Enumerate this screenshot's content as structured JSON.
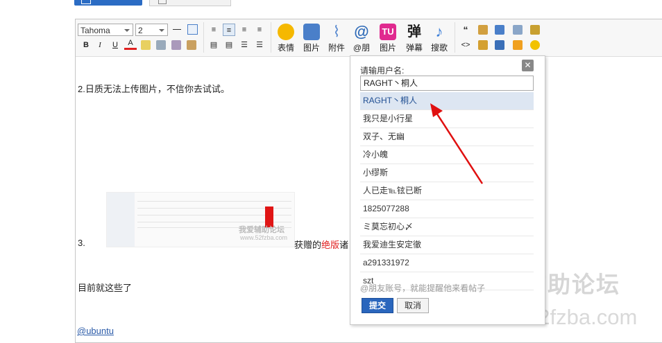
{
  "toolbar": {
    "font_family": "Tahoma",
    "font_size": "2",
    "format_buttons": [
      {
        "label": "B",
        "icon": "bold-icon"
      },
      {
        "label": "I",
        "icon": "italic-icon"
      },
      {
        "label": "U",
        "icon": "underline-icon"
      },
      {
        "label": "A",
        "icon": "font-color-icon"
      }
    ],
    "big_buttons": [
      {
        "label": "表情",
        "icon": "smiley-icon",
        "color": "#f5b800"
      },
      {
        "label": "图片",
        "icon": "image-icon",
        "color": "#4a7fc9"
      },
      {
        "label": "附件",
        "icon": "paperclip-icon",
        "color": "#5b8bd0"
      },
      {
        "label": "@朋",
        "icon": "at-icon",
        "color": "#2f6bb8"
      },
      {
        "label": "图片",
        "icon": "tu-icon",
        "color": "#e02a8f",
        "glyph": "TU"
      },
      {
        "label": "弹幕",
        "icon": "danmu-icon",
        "color": "#222222",
        "glyph": "弹"
      },
      {
        "label": "搜歌",
        "icon": "music-note-icon",
        "color": "#3c7fd8",
        "glyph": "♪"
      }
    ]
  },
  "content": {
    "line1": "2.日质无法上传图片，不信你去试试。",
    "line3_prefix": "3.",
    "line3_after": "获赠的",
    "line3_red": "绝版",
    "line3_tail": "诸",
    "line4": "目前就这些了",
    "mention": "@ubuntu"
  },
  "popup": {
    "title": "请输用户名:",
    "input_value": "RAGHT丶桐人",
    "suggestions": [
      "RAGHT丶桐人",
      "我只是小行星",
      "双子、无幽",
      "冷小魄",
      "小缪斯",
      "人已走℡铉已断",
      "1825077288",
      "ミ莫忘初心〆",
      "我爱迪生安定徹",
      "a291331972",
      "szt"
    ],
    "hint": "@朋友账号，就能提醒他来看帖子",
    "submit_label": "提交",
    "cancel_label": "取消",
    "close_glyph": "✕"
  },
  "watermark": {
    "title": "我爱辅助论坛",
    "url": "www.52fzba.com",
    "thumb_text": "我爱辅助论坛",
    "thumb_url": "www.52fzba.com"
  },
  "colors": {
    "accent": "#2a66bd",
    "highlight_row": "#dde6f2",
    "arrow": "#e01010"
  }
}
